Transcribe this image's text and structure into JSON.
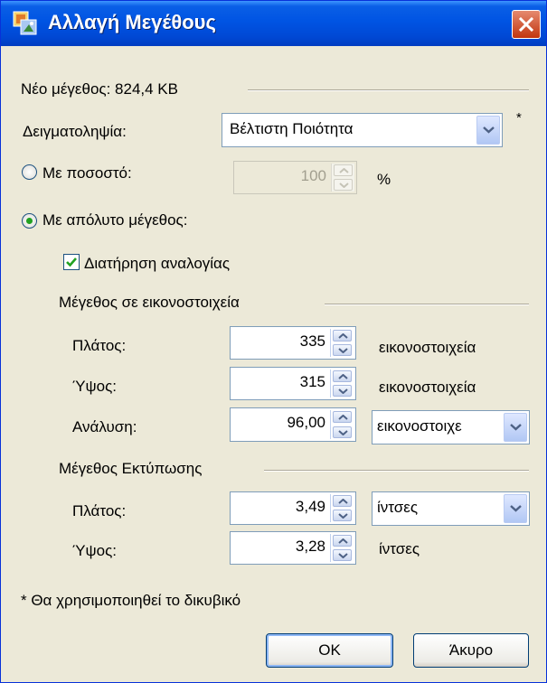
{
  "window": {
    "title": "Αλλαγή Μεγέθους"
  },
  "new_size": {
    "label": "Νέο μέγεθος: 824,4 KB"
  },
  "sampling": {
    "label": "Δειγματοληψία:",
    "value": "Βέλτιστη Ποιότητα",
    "asterisk": "*"
  },
  "by_percent": {
    "label": "Με ποσοστό:",
    "value": "100",
    "unit": "%",
    "selected": false
  },
  "by_absolute": {
    "label": "Με απόλυτο μέγεθος:",
    "selected": true
  },
  "keep_ratio": {
    "label": "Διατήρηση αναλογίας",
    "checked": true
  },
  "pixel_size": {
    "heading": "Μέγεθος σε εικονοστοιχεία",
    "width": {
      "label": "Πλάτος:",
      "value": "335",
      "unit": "εικονοστοιχεία"
    },
    "height": {
      "label": "Ύψος:",
      "value": "315",
      "unit": "εικονοστοιχεία"
    },
    "resolution": {
      "label": "Ανάλυση:",
      "value": "96,00",
      "unit": "εικονοστοιχε"
    }
  },
  "print_size": {
    "heading": "Μέγεθος Εκτύπωσης",
    "width": {
      "label": "Πλάτος:",
      "value": "3,49",
      "unit": "ίντσες"
    },
    "height": {
      "label": "Ύψος:",
      "value": "3,28",
      "unit": "ίντσες"
    }
  },
  "footnote": "* Θα χρησιμοποιηθεί το δικυβικό",
  "buttons": {
    "ok": "OK",
    "cancel": "Άκυρο"
  },
  "colors": {
    "title_bar": "#0054e3",
    "dialog_bg": "#ece9d8",
    "close_button": "#c2350f",
    "check_green": "#21a121"
  }
}
